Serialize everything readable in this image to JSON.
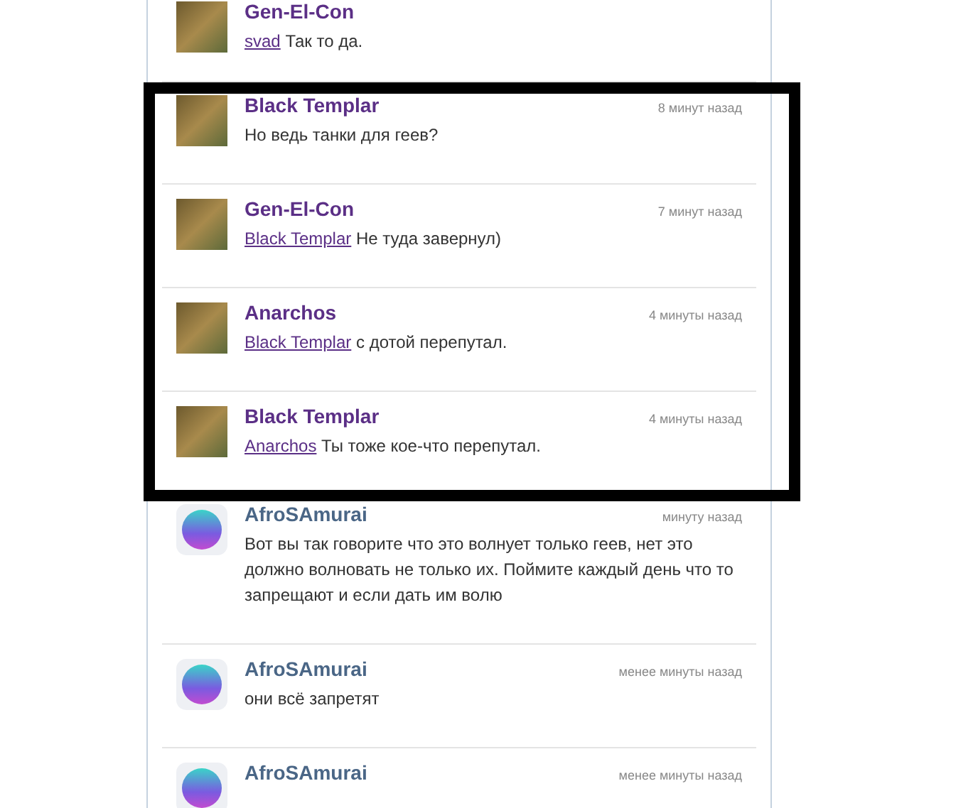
{
  "comments": [
    {
      "author": "Gen-El-Con",
      "color": "#5b2f86",
      "kind": "photo",
      "highlighted": false,
      "mention": "svad",
      "text": "Так то да."
    },
    {
      "author": "Black Templar",
      "color": "#5b2f86",
      "kind": "photo",
      "highlighted": true,
      "time": "8 минут назад",
      "text": "Но ведь танки для геев?"
    },
    {
      "author": "Gen-El-Con",
      "color": "#5b2f86",
      "kind": "photo",
      "highlighted": true,
      "time": "7 минут назад",
      "mention": "Black Templar",
      "text": "Не туда завернул)"
    },
    {
      "author": "Anarchos",
      "color": "#5b2f86",
      "kind": "photo",
      "highlighted": true,
      "time": "4 минуты назад",
      "mention": "Black Templar",
      "text": "с дотой перепутал."
    },
    {
      "author": "Black Templar",
      "color": "#5b2f86",
      "kind": "photo",
      "highlighted": true,
      "time": "4 минуты назад",
      "mention": "Anarchos",
      "text": "Ты тоже кое-что перепутал."
    },
    {
      "author": "AfroSAmurai",
      "color": "#4a6686",
      "kind": "logo",
      "highlighted": false,
      "time": "минуту назад",
      "text": "Вот вы так говорите что это волнует только геев, нет это должно волновать не только их. Поймите каждый день что то запрещают и если дать им волю"
    },
    {
      "author": "AfroSAmurai",
      "color": "#4a6686",
      "kind": "logo",
      "highlighted": false,
      "time": "менее минуты назад",
      "text": "они всё запретят"
    },
    {
      "author": "AfroSAmurai",
      "color": "#4a6686",
      "kind": "logo",
      "highlighted": false,
      "time": "менее минуты назад"
    }
  ]
}
